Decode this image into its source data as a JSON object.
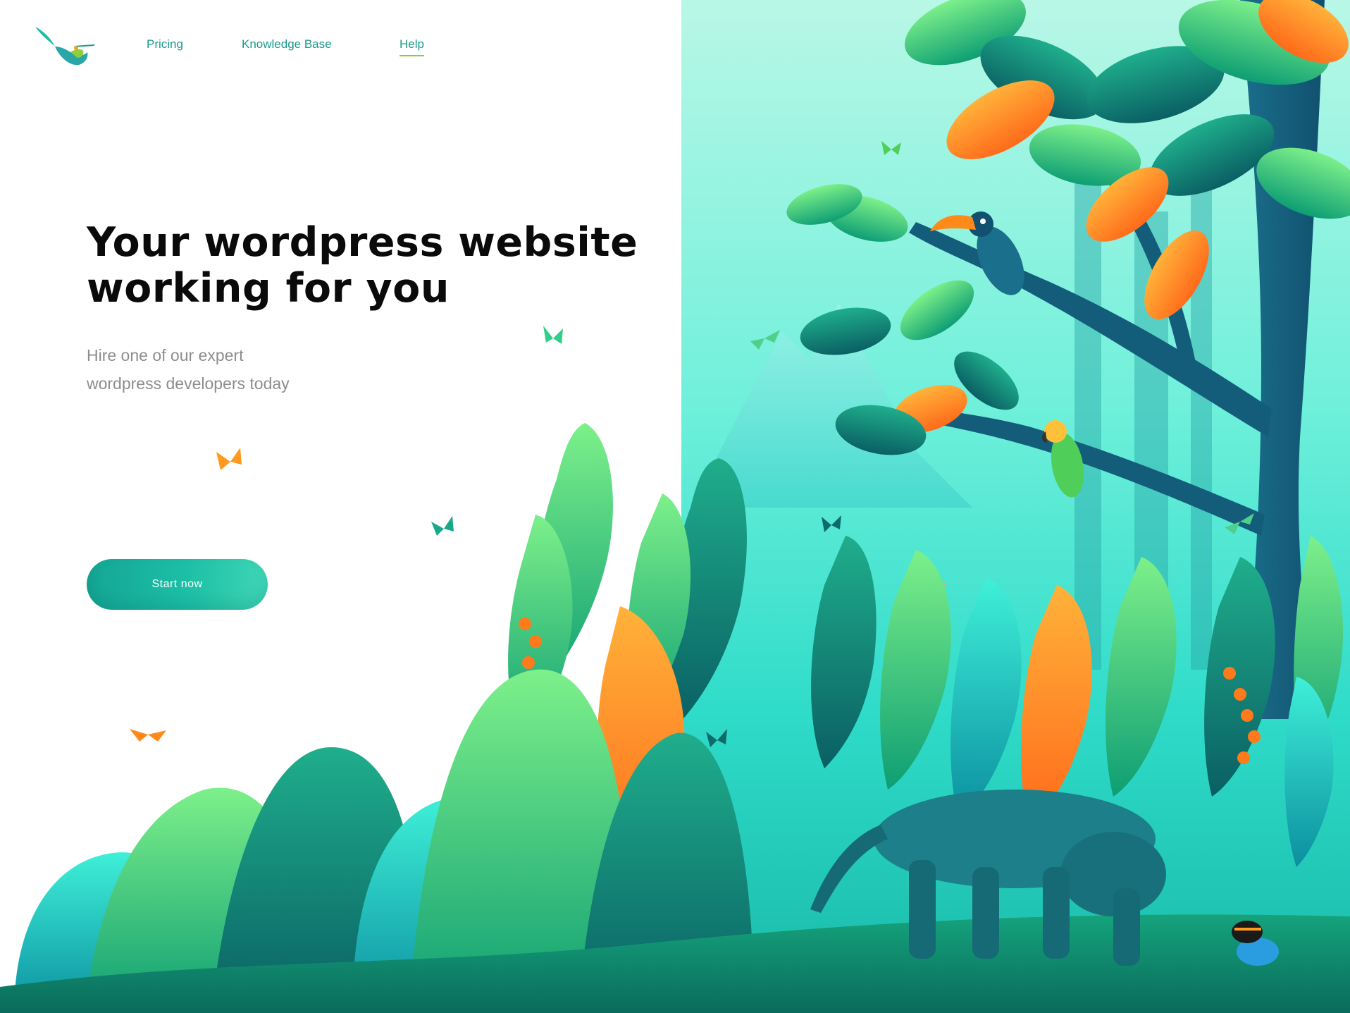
{
  "nav": {
    "logo_icon": "hummingbird-logo-icon",
    "links": [
      {
        "label": "Pricing",
        "active": false
      },
      {
        "label": "Knowledge Base",
        "active": false
      },
      {
        "label": "Help",
        "active": true
      }
    ]
  },
  "hero": {
    "title_line1": "Your wordpress website",
    "title_line2": "working for you",
    "subtitle_line1": "Hire one of our expert",
    "subtitle_line2": "wordpress developers today",
    "cta_label": "Start now"
  },
  "illustration": {
    "subject": "jungle-illustration",
    "elements": [
      "tree",
      "toucan",
      "parrot",
      "butterflies",
      "tropical-leaves",
      "jaguar",
      "poison-dart-frog",
      "mountain"
    ]
  },
  "colors": {
    "accent": "#1cbfa6",
    "nav_link": "#1a9a8a",
    "active_underline": "#8bcf3a",
    "title": "#0a0a0a",
    "subtitle": "#8d8d8d",
    "sky_top": "#b9f7e6",
    "sky_bottom": "#18b8a8",
    "orange": "#ff9a1f"
  }
}
